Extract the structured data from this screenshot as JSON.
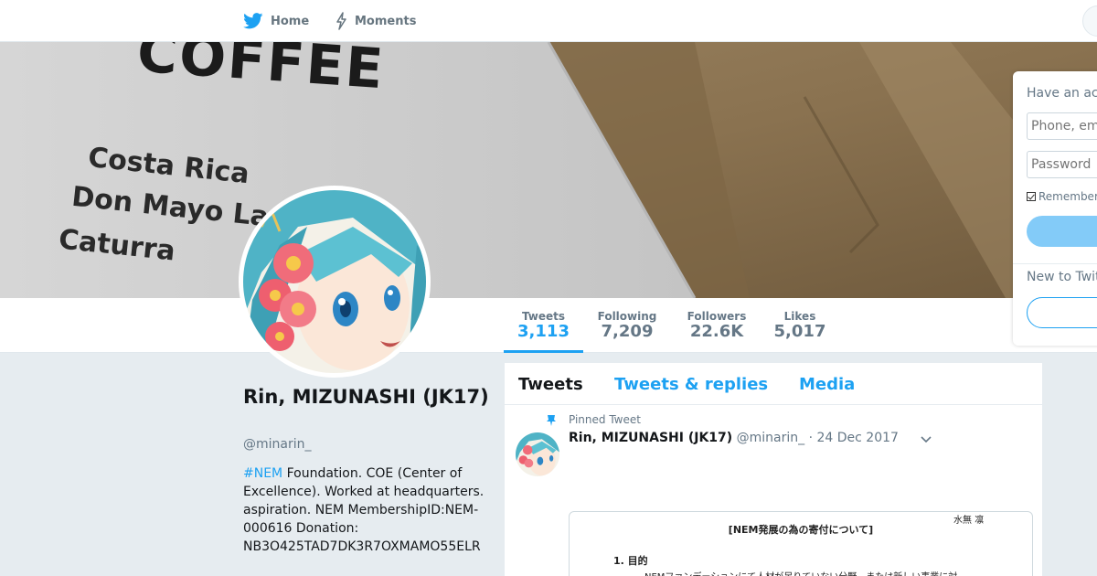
{
  "nav": {
    "home_label": "Home",
    "moments_label": "Moments"
  },
  "banner": {
    "lines": [
      "COFFEE",
      "Costa Rica",
      "Don Mayo La",
      "Caturra"
    ]
  },
  "stats": {
    "tweets": {
      "label": "Tweets",
      "value": "3,113"
    },
    "following": {
      "label": "Following",
      "value": "7,209"
    },
    "followers": {
      "label": "Followers",
      "value": "22.6K"
    },
    "likes": {
      "label": "Likes",
      "value": "5,017"
    }
  },
  "profile": {
    "name": "Rin, MIZUNASHI (JK17)",
    "handle": "@minarin_",
    "bio_hashtag": "#NEM",
    "bio_text": " Foundation. COE (Center of Excellence). Worked at headquarters. aspiration. NEM MembershipID:NEM-000616 Donation: NB3O425TAD7DK3R7OXMAMO55ELR"
  },
  "timeline": {
    "tabs": [
      "Tweets",
      "Tweets & replies",
      "Media"
    ],
    "pinned_label": "Pinned Tweet",
    "tweet": {
      "name": "Rin, MIZUNASHI (JK17)",
      "handle": "@minarin_",
      "date": "· 24 Dec 2017",
      "doc_signature": "水無 凛",
      "doc_title": "[NEM発展の為の寄付について]",
      "doc_heading": "1.  目的",
      "doc_line": "NEMファンデーションにて人材が足りていない分野、または新しい事業に対"
    }
  },
  "login": {
    "heading": "Have an account?",
    "phone_placeholder": "Phone, email or username",
    "password_placeholder": "Password",
    "remember_label": "Remember me",
    "new_heading": "New to Twitter?"
  },
  "colors": {
    "accent": "#1da1f2",
    "muted": "#657786",
    "background": "#e6ecf0"
  }
}
